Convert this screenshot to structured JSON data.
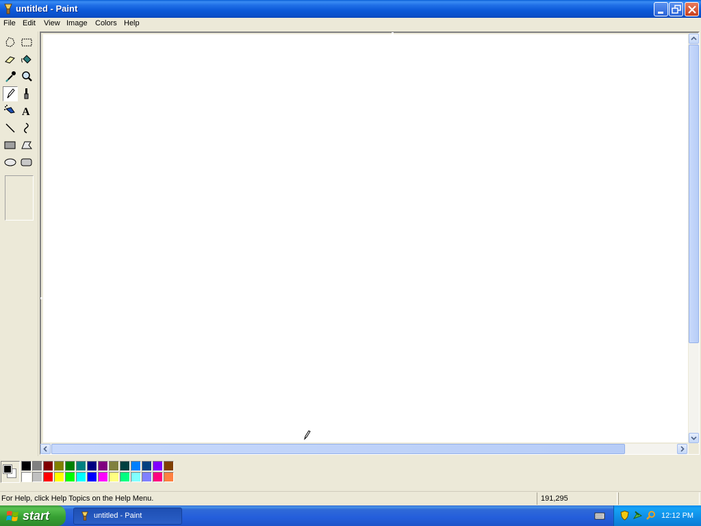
{
  "window": {
    "title": "untitled - Paint",
    "controls": [
      "minimize",
      "maximize",
      "close"
    ]
  },
  "menu": {
    "items": [
      "File",
      "Edit",
      "View",
      "Image",
      "Colors",
      "Help"
    ]
  },
  "toolbox": {
    "tools": [
      {
        "name": "free-form-select",
        "icon": "freeform-select-icon"
      },
      {
        "name": "select",
        "icon": "rect-select-icon"
      },
      {
        "name": "eraser",
        "icon": "eraser-icon"
      },
      {
        "name": "fill-with-color",
        "icon": "fill-bucket-icon"
      },
      {
        "name": "pick-color",
        "icon": "eyedropper-icon"
      },
      {
        "name": "magnifier",
        "icon": "magnifier-icon"
      },
      {
        "name": "pencil",
        "icon": "pencil-icon",
        "selected": true
      },
      {
        "name": "brush",
        "icon": "brush-icon"
      },
      {
        "name": "airbrush",
        "icon": "airbrush-icon"
      },
      {
        "name": "text",
        "icon": "text-icon"
      },
      {
        "name": "line",
        "icon": "line-icon"
      },
      {
        "name": "curve",
        "icon": "curve-icon"
      },
      {
        "name": "rectangle",
        "icon": "rectangle-icon"
      },
      {
        "name": "polygon",
        "icon": "polygon-icon"
      },
      {
        "name": "ellipse",
        "icon": "ellipse-icon"
      },
      {
        "name": "rounded-rectangle",
        "icon": "rounded-rect-icon"
      }
    ]
  },
  "palette": {
    "foreground": "#000000",
    "background": "#ffffff",
    "top_row": [
      "#000000",
      "#808080",
      "#800000",
      "#808000",
      "#008000",
      "#008080",
      "#000080",
      "#800080",
      "#808040",
      "#004040",
      "#0080ff",
      "#004080",
      "#8000ff",
      "#804000"
    ],
    "bottom_row": [
      "#ffffff",
      "#c0c0c0",
      "#ff0000",
      "#ffff00",
      "#00ff00",
      "#00ffff",
      "#0000ff",
      "#ff00ff",
      "#ffff80",
      "#00ff80",
      "#80ffff",
      "#8080ff",
      "#ff0080",
      "#ff8040"
    ]
  },
  "statusbar": {
    "help_text": "For Help, click Help Topics on the Help Menu.",
    "coordinates": "191,295"
  },
  "taskbar": {
    "start_label": "start",
    "task_label": "untitled - Paint",
    "clock": "12:12 PM"
  }
}
